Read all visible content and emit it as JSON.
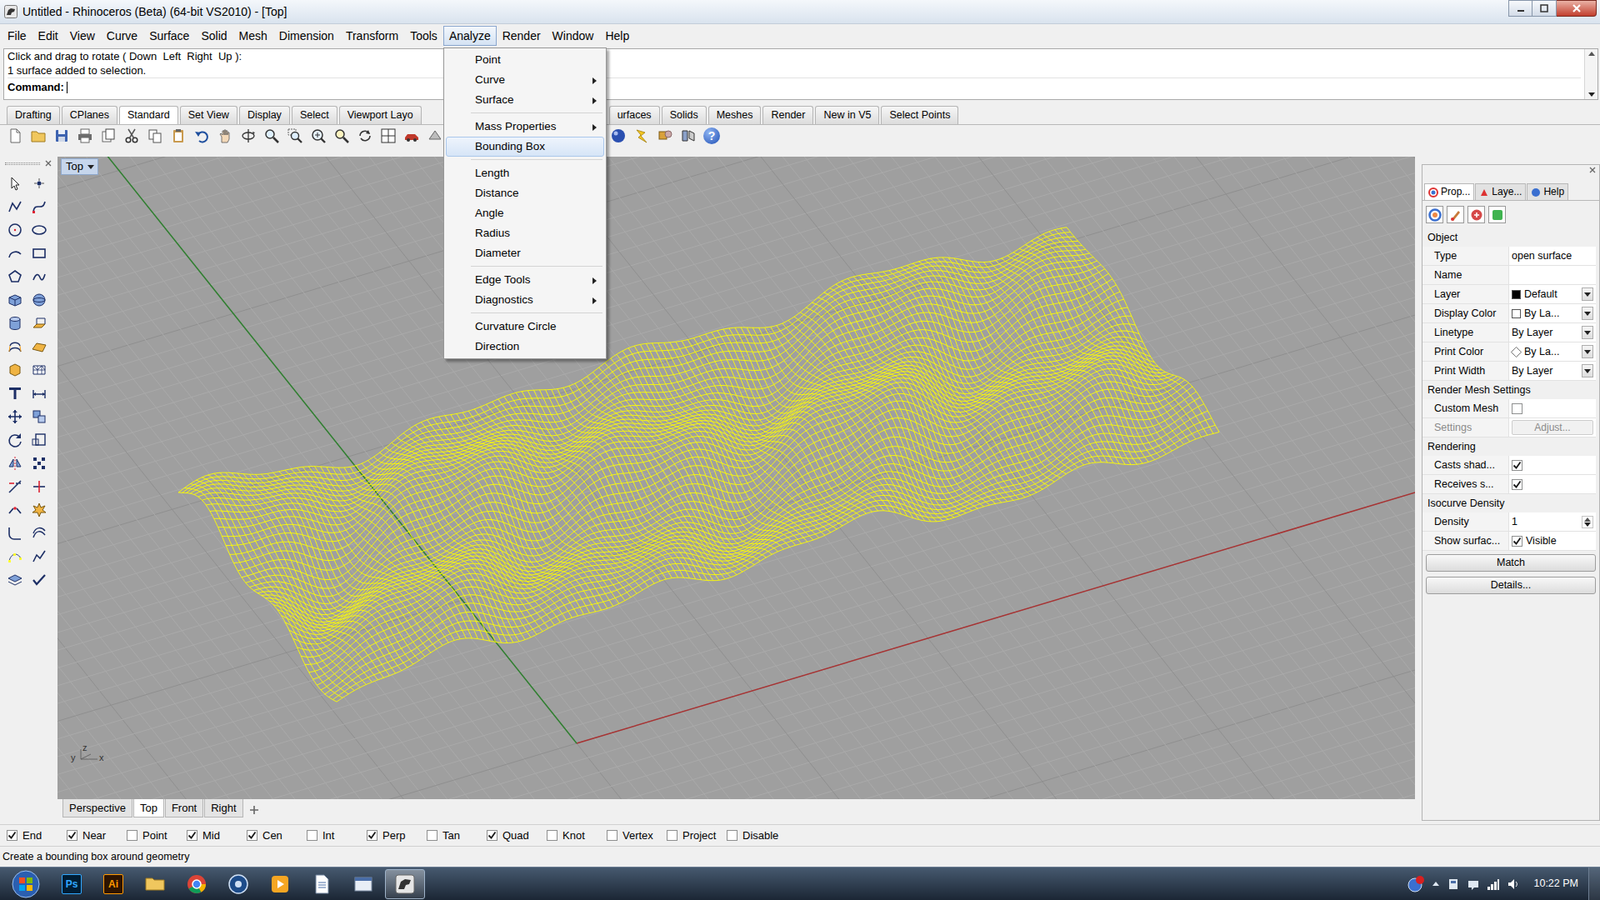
{
  "window": {
    "title": "Untitled - Rhinoceros (Beta) (64-bit VS2010) - [Top]"
  },
  "menu": [
    {
      "label": "File",
      "selected": false
    },
    {
      "label": "Edit",
      "selected": false
    },
    {
      "label": "View",
      "selected": false
    },
    {
      "label": "Curve",
      "selected": false
    },
    {
      "label": "Surface",
      "selected": false
    },
    {
      "label": "Solid",
      "selected": false
    },
    {
      "label": "Mesh",
      "selected": false
    },
    {
      "label": "Dimension",
      "selected": false
    },
    {
      "label": "Transform",
      "selected": false
    },
    {
      "label": "Tools",
      "selected": false
    },
    {
      "label": "Analyze",
      "selected": true
    },
    {
      "label": "Render",
      "selected": false
    },
    {
      "label": "Window",
      "selected": false
    },
    {
      "label": "Help",
      "selected": false
    }
  ],
  "command": {
    "lines": [
      "Click and drag to rotate ( Down  Left  Right  Up ):",
      "1 surface added to selection."
    ],
    "prompt": "Command:"
  },
  "toolbar_tabs": {
    "left": [
      {
        "label": "Drafting",
        "selected": false
      },
      {
        "label": "CPlanes",
        "selected": false
      },
      {
        "label": "Standard",
        "selected": true
      },
      {
        "label": "Set View",
        "selected": false
      },
      {
        "label": "Display",
        "selected": false
      },
      {
        "label": "Select",
        "selected": false
      },
      {
        "label": "Viewport Layo",
        "selected": false
      }
    ],
    "right": [
      {
        "label": "urfaces",
        "selected": false
      },
      {
        "label": "Solids",
        "selected": false
      },
      {
        "label": "Meshes",
        "selected": false
      },
      {
        "label": "Render",
        "selected": false
      },
      {
        "label": "New in V5",
        "selected": false
      },
      {
        "label": "Select Points",
        "selected": false
      }
    ]
  },
  "toolbar": {
    "help_glyph": "?"
  },
  "analyze_menu": [
    {
      "kind": "item",
      "label": "Point",
      "submenu": false,
      "selected": false
    },
    {
      "kind": "item",
      "label": "Curve",
      "submenu": true,
      "selected": false
    },
    {
      "kind": "item",
      "label": "Surface",
      "submenu": true,
      "selected": false
    },
    {
      "kind": "separator"
    },
    {
      "kind": "item",
      "label": "Mass Properties",
      "submenu": true,
      "selected": false
    },
    {
      "kind": "item",
      "label": "Bounding Box",
      "submenu": false,
      "selected": true
    },
    {
      "kind": "separator"
    },
    {
      "kind": "item",
      "label": "Length",
      "submenu": false,
      "selected": false
    },
    {
      "kind": "item",
      "label": "Distance",
      "submenu": false,
      "selected": false
    },
    {
      "kind": "item",
      "label": "Angle",
      "submenu": false,
      "selected": false
    },
    {
      "kind": "item",
      "label": "Radius",
      "submenu": false,
      "selected": false
    },
    {
      "kind": "item",
      "label": "Diameter",
      "submenu": false,
      "selected": false
    },
    {
      "kind": "separator"
    },
    {
      "kind": "item",
      "label": "Edge Tools",
      "submenu": true,
      "selected": false
    },
    {
      "kind": "item",
      "label": "Diagnostics",
      "submenu": true,
      "selected": false
    },
    {
      "kind": "separator"
    },
    {
      "kind": "item",
      "label": "Curvature Circle",
      "submenu": false,
      "selected": false
    },
    {
      "kind": "item",
      "label": "Direction",
      "submenu": false,
      "selected": false
    }
  ],
  "viewport": {
    "label": "Top",
    "axes": [
      "y",
      "z",
      "x"
    ]
  },
  "viewport_tabs": [
    {
      "label": "Perspective",
      "selected": false
    },
    {
      "label": "Top",
      "selected": true
    },
    {
      "label": "Front",
      "selected": false
    },
    {
      "label": "Right",
      "selected": false
    }
  ],
  "osnaps": [
    {
      "label": "End",
      "checked": true
    },
    {
      "label": "Near",
      "checked": true
    },
    {
      "label": "Point",
      "checked": false
    },
    {
      "label": "Mid",
      "checked": true
    },
    {
      "label": "Cen",
      "checked": true
    },
    {
      "label": "Int",
      "checked": false
    },
    {
      "label": "Perp",
      "checked": true
    },
    {
      "label": "Tan",
      "checked": false
    },
    {
      "label": "Quad",
      "checked": true
    },
    {
      "label": "Knot",
      "checked": false
    },
    {
      "label": "Vertex",
      "checked": false
    },
    {
      "label": "Project",
      "checked": false
    },
    {
      "label": "Disable",
      "checked": false
    }
  ],
  "status": "Create a bounding box around geometry",
  "panel": {
    "tabs": [
      {
        "label": "Prop...",
        "selected": true
      },
      {
        "label": "Laye...",
        "selected": false
      },
      {
        "label": "Help",
        "selected": false
      }
    ],
    "rows": [
      {
        "kind": "section",
        "label": "Object"
      },
      {
        "kind": "text",
        "label": "Type",
        "value": "open surface"
      },
      {
        "kind": "text",
        "label": "Name",
        "value": ""
      },
      {
        "kind": "dropdown",
        "label": "Layer",
        "value": "Default",
        "swatch": "square",
        "color": "#000000"
      },
      {
        "kind": "dropdown",
        "label": "Display Color",
        "value": "By La...",
        "swatch": "square",
        "color": "#ffffff"
      },
      {
        "kind": "dropdown",
        "label": "Linetype",
        "value": "By Layer"
      },
      {
        "kind": "dropdown",
        "label": "Print Color",
        "value": "By La...",
        "swatch": "diamond",
        "color": "#ffffff"
      },
      {
        "kind": "dropdown",
        "label": "Print Width",
        "value": "By Layer"
      },
      {
        "kind": "section",
        "label": "Render Mesh Settings"
      },
      {
        "kind": "check",
        "label": "Custom Mesh",
        "checked": false,
        "value": ""
      },
      {
        "kind": "button",
        "label": "Settings",
        "value": "Adjust...",
        "disabled": true
      },
      {
        "kind": "section",
        "label": "Rendering"
      },
      {
        "kind": "check",
        "label": "Casts shad...",
        "checked": true,
        "value": ""
      },
      {
        "kind": "check",
        "label": "Receives s...",
        "checked": true,
        "value": ""
      },
      {
        "kind": "section",
        "label": "Isocurve Density"
      },
      {
        "kind": "spin",
        "label": "Density",
        "value": "1"
      },
      {
        "kind": "check",
        "label": "Show surfac...",
        "checked": true,
        "value": "Visible"
      }
    ],
    "buttons": [
      "Match",
      "Details..."
    ]
  },
  "taskbar": {
    "apps": [
      {
        "kind": "ps",
        "label": "Ps",
        "selected": false
      },
      {
        "kind": "ai",
        "label": "Ai",
        "selected": false
      },
      {
        "kind": "folder",
        "selected": false
      },
      {
        "kind": "chrome",
        "selected": false
      },
      {
        "kind": "disc",
        "selected": false
      },
      {
        "kind": "media",
        "selected": false
      },
      {
        "kind": "docs",
        "selected": false
      },
      {
        "kind": "window",
        "selected": false
      },
      {
        "kind": "rhino",
        "selected": true
      }
    ],
    "time": "10:22 PM"
  }
}
